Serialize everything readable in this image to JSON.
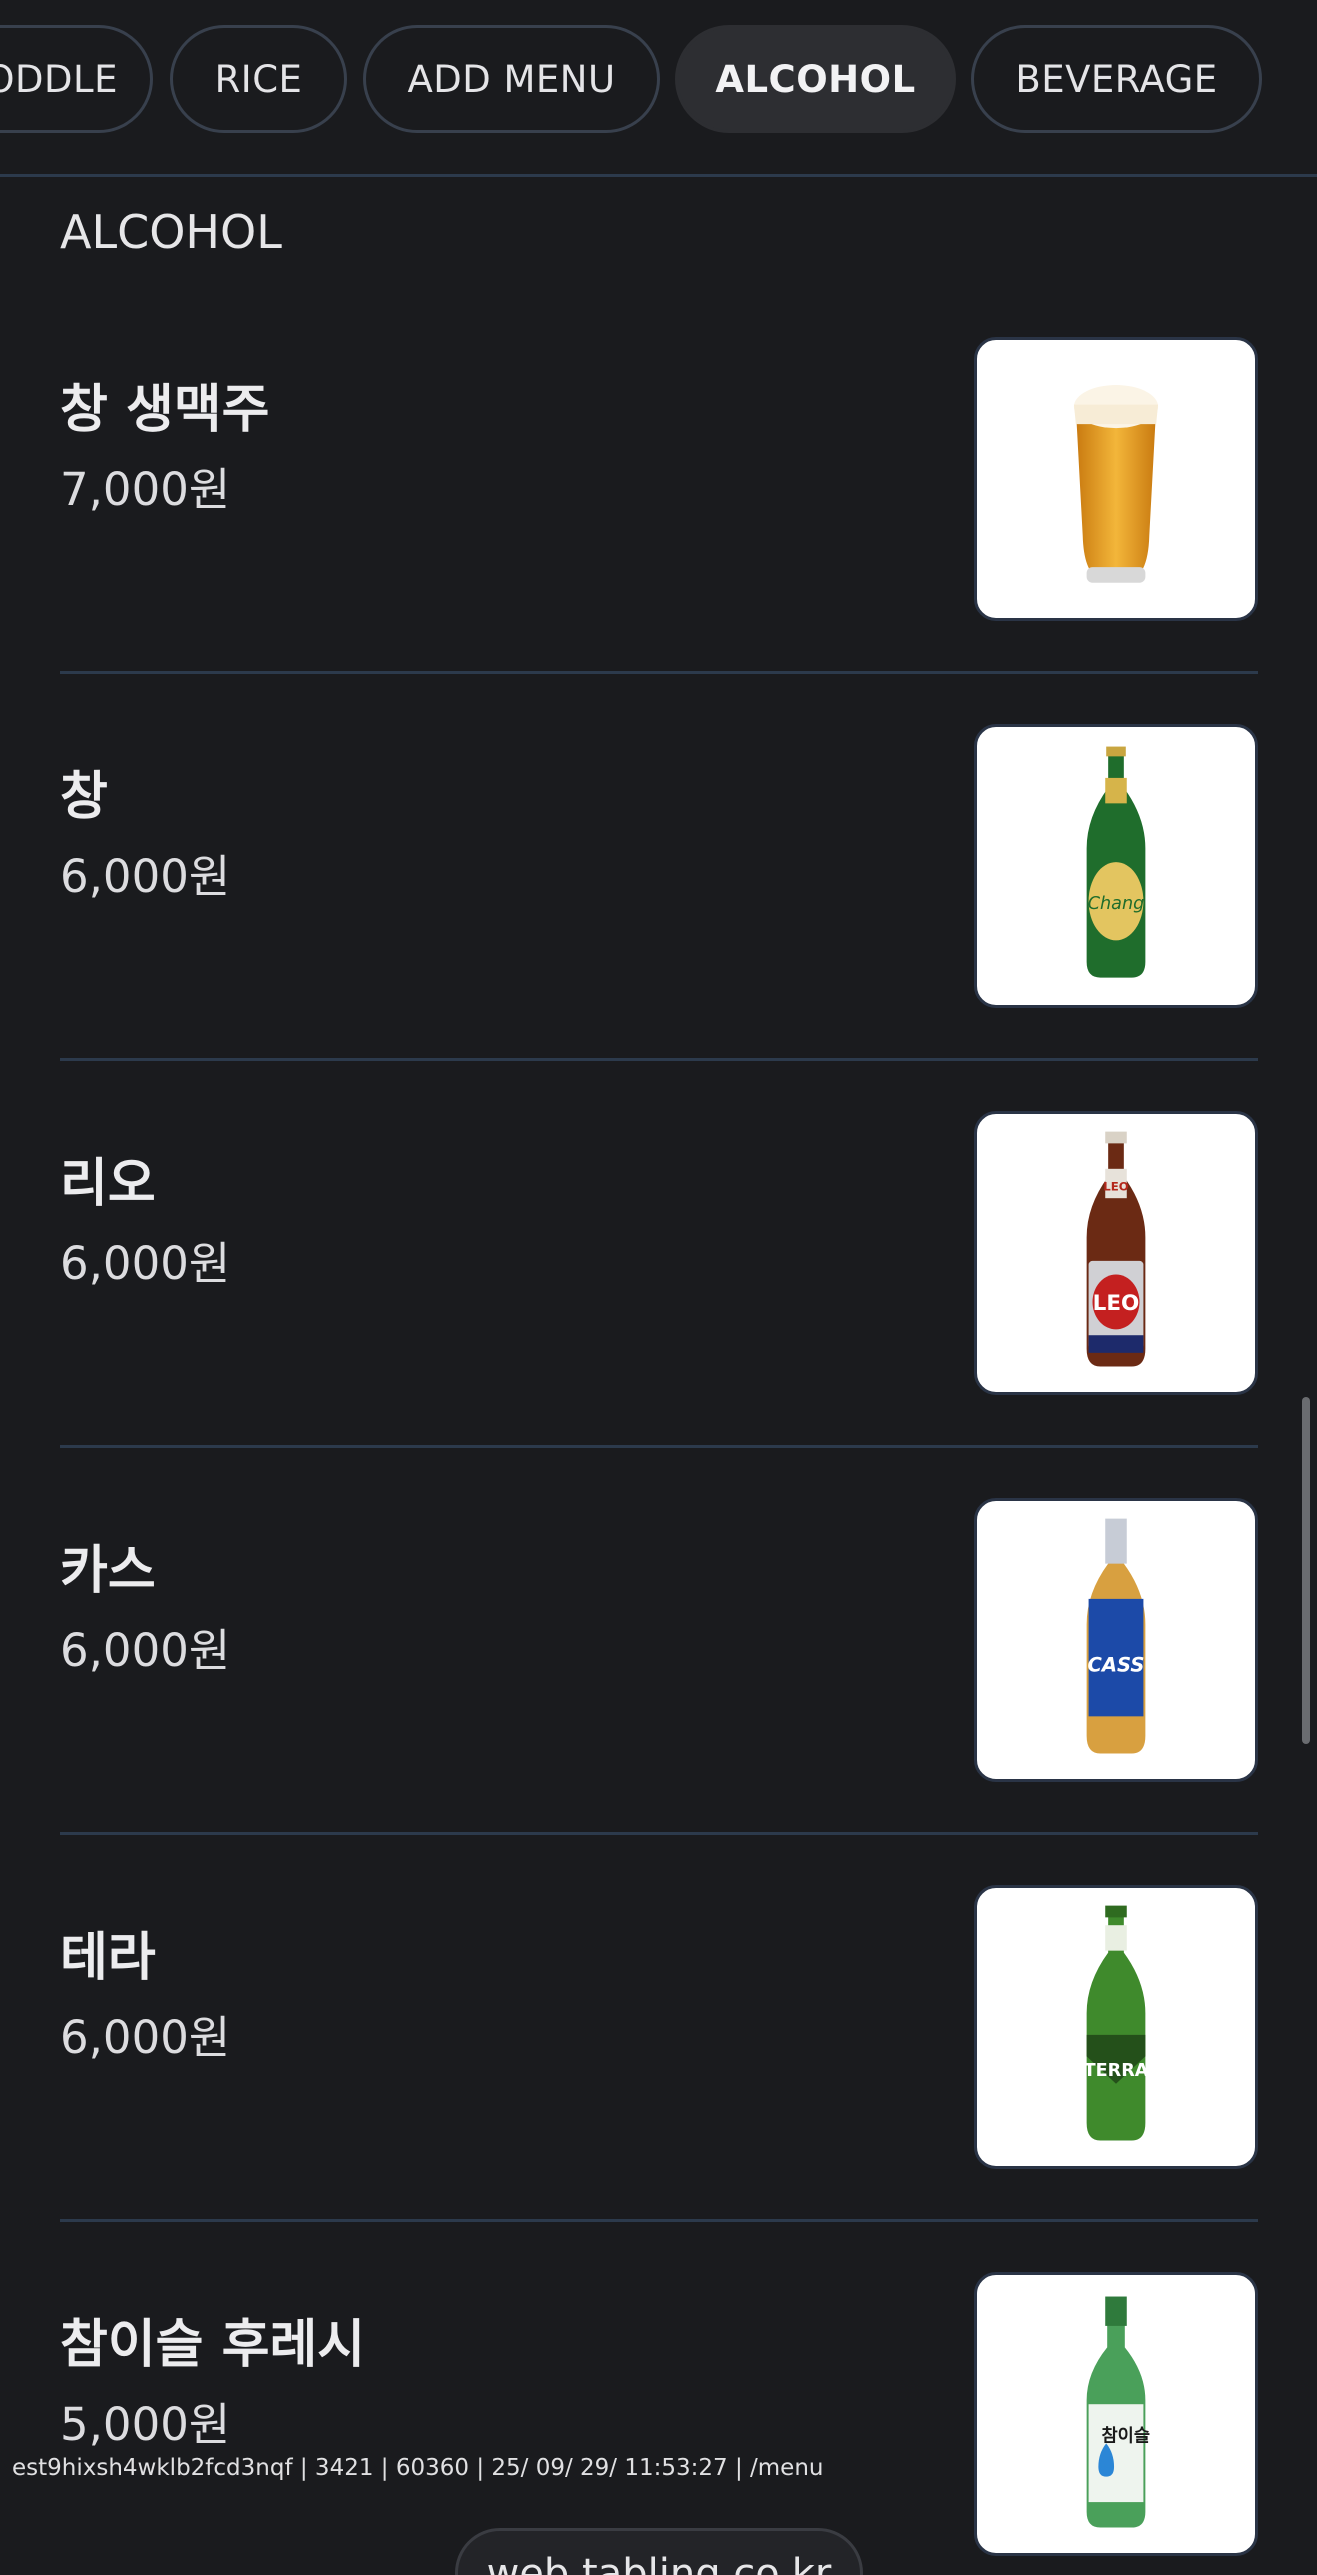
{
  "tabs": [
    {
      "label": "ODDLE"
    },
    {
      "label": "RICE"
    },
    {
      "label": "ADD MENU"
    },
    {
      "label": "ALCOHOL",
      "active": true
    },
    {
      "label": "BEVERAGE"
    }
  ],
  "section": {
    "title": "ALCOHOL"
  },
  "items": [
    {
      "name": "창 생맥주",
      "price": "7,000원",
      "image": "draft-beer-glass"
    },
    {
      "name": "창",
      "price": "6,000원",
      "image": "chang-beer-bottle",
      "label": "Chang"
    },
    {
      "name": "리오",
      "price": "6,000원",
      "image": "leo-beer-bottle",
      "label": "LEO"
    },
    {
      "name": "카스",
      "price": "6,000원",
      "image": "cass-beer-bottle",
      "label": "CASS"
    },
    {
      "name": "테라",
      "price": "6,000원",
      "image": "terra-beer-bottle",
      "label": "TERRA"
    },
    {
      "name": "참이슬 후레시",
      "price": "5,000원",
      "image": "chamisul-soju-bottle",
      "label": "참이슬"
    }
  ],
  "footer": {
    "debug": "est9hixsh4wklb2fcd3nqf | 3421 | 60360 | 25/ 09/ 29/ 11:53:27 | /menu",
    "url": "web.tabling.co.kr"
  },
  "colors": {
    "background": "#1a1b1e",
    "active_tab": "#2d2e32",
    "divider": "#2c3a4c"
  }
}
